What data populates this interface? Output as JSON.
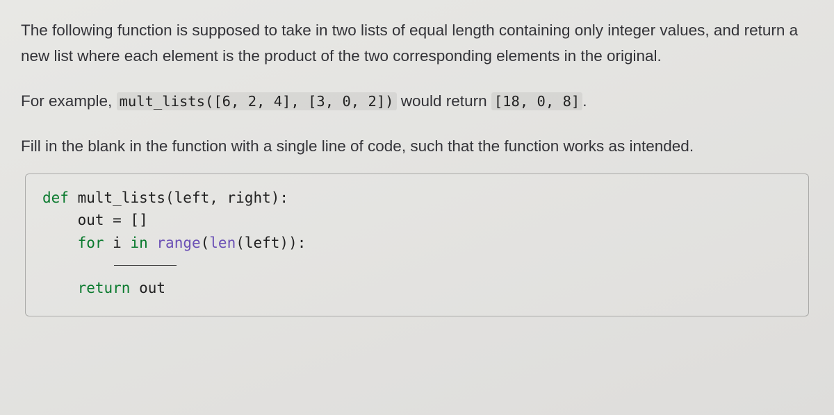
{
  "prose": {
    "p1": "The following function is supposed to take in two lists of equal length containing only integer values, and return a new list where each element is the product of the two corresponding elements in the original.",
    "p2a": "For example, ",
    "code_example_call": "mult_lists([6, 2, 4], [3, 0, 2])",
    "p2b": " would return ",
    "code_example_result": "[18, 0, 8]",
    "p2c": ".",
    "p3": "Fill in the blank in the function with a single line of code, such that the function works as intended."
  },
  "code": {
    "l1_def": "def",
    "l1_rest": " mult_lists(left, right):",
    "l2": "    out = []",
    "l3_for": "    for",
    "l3_mid": " i ",
    "l3_in": "in",
    "l3_space": " ",
    "l3_range": "range",
    "l3_paren1": "(",
    "l3_len": "len",
    "l3_rest": "(left)):",
    "l5_return": "    return",
    "l5_rest": " out"
  }
}
